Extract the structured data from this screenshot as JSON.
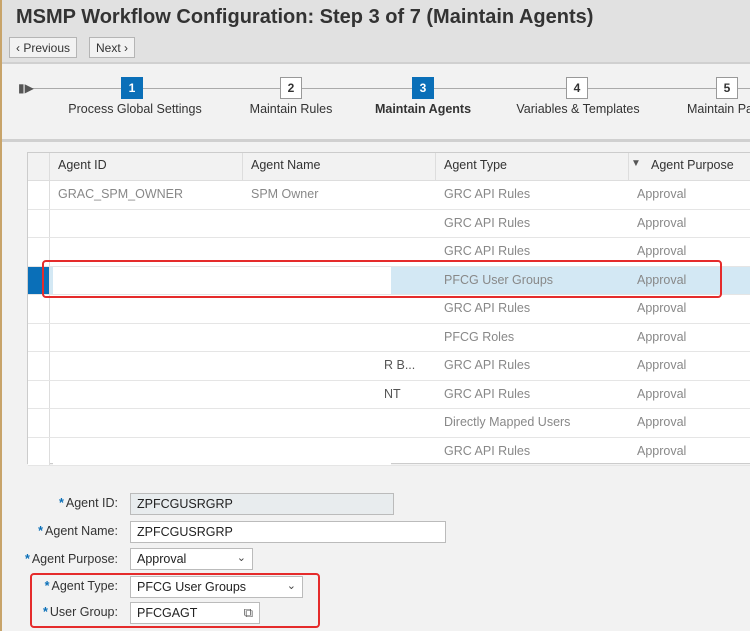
{
  "header": {
    "title": "MSMP Workflow Configuration: Step 3  of 7  (Maintain Agents)",
    "previous_label": "‹ Previous",
    "next_label": "Next ›"
  },
  "roadmap": {
    "start_icon": "roadmap-start-icon",
    "steps": [
      {
        "number": "1",
        "label": "Process Global Settings",
        "completed": true
      },
      {
        "number": "2",
        "label": "Maintain Rules",
        "completed": false
      },
      {
        "number": "3",
        "label": "Maintain Agents",
        "current": true
      },
      {
        "number": "4",
        "label": "Variables & Templates"
      },
      {
        "number": "5",
        "label": "Maintain Pa"
      }
    ]
  },
  "table": {
    "columns": [
      "Agent ID",
      "Agent Name",
      "Agent Type",
      "Agent Purpose"
    ],
    "rows": [
      {
        "id": "GRAC_SPM_OWNER",
        "name": "SPM Owner",
        "type": "GRC API Rules",
        "purpose": "Approval"
      },
      {
        "id": "",
        "name": "",
        "type": "GRC API Rules",
        "purpose": "Approval"
      },
      {
        "id": "",
        "name": "",
        "type": "GRC API Rules",
        "purpose": "Approval"
      },
      {
        "id": "",
        "name": "",
        "type": "PFCG User Groups",
        "purpose": "Approval",
        "selected": true
      },
      {
        "id": "",
        "name": "",
        "type": "GRC API Rules",
        "purpose": "Approval"
      },
      {
        "id": "",
        "name": "",
        "type": "PFCG Roles",
        "purpose": "Approval"
      },
      {
        "id": "",
        "name": "R B...",
        "type": "GRC API Rules",
        "purpose": "Approval"
      },
      {
        "id": "",
        "name": "NT",
        "type": "GRC API Rules",
        "purpose": "Approval"
      },
      {
        "id": "",
        "name": "",
        "type": "Directly Mapped Users",
        "purpose": "Approval"
      },
      {
        "id": "",
        "name": "",
        "type": "GRC API Rules",
        "purpose": "Approval"
      }
    ]
  },
  "form": {
    "agent_id_label": "Agent ID:",
    "agent_id": "ZPFCGUSRGRP",
    "agent_name_label": "Agent Name:",
    "agent_name": "ZPFCGUSRGRP",
    "purpose_label": "Agent Purpose:",
    "purpose": "Approval",
    "type_label": "Agent Type:",
    "type": "PFCG User Groups",
    "user_group_label": "User Group:",
    "user_group": "PFCGAGT",
    "required": "*"
  }
}
